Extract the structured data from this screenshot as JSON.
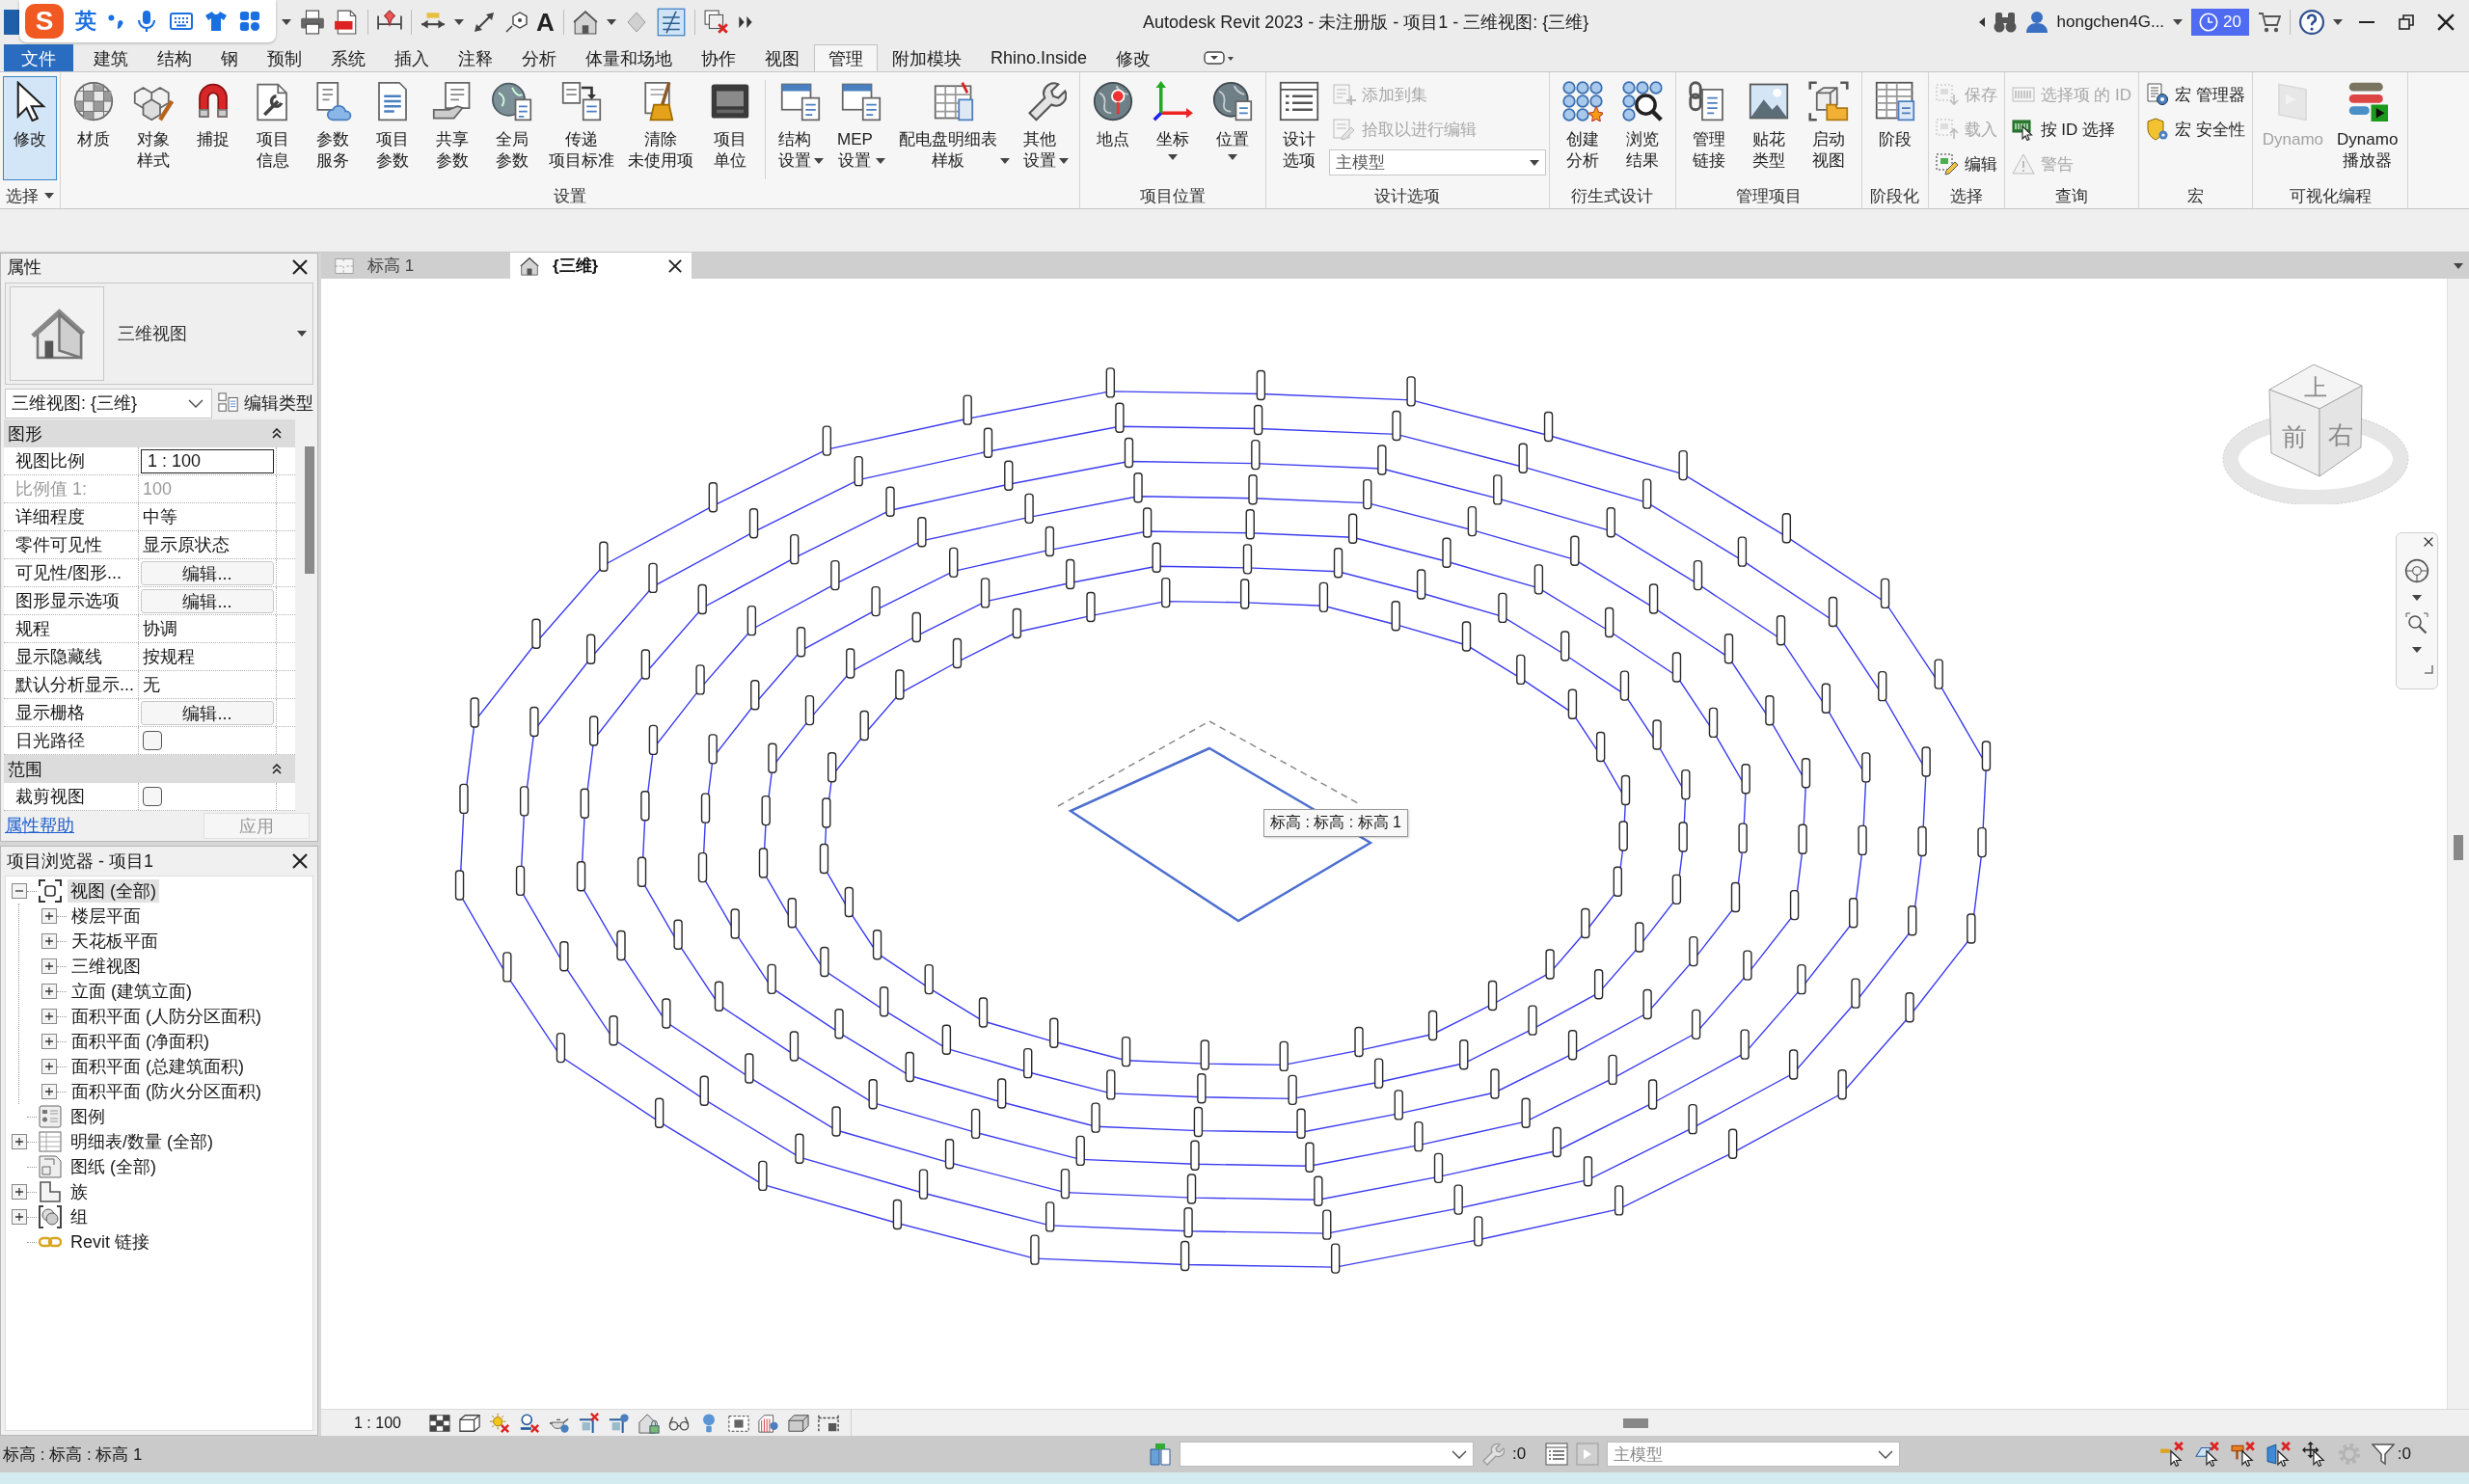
{
  "title_bar": {
    "logo": "S",
    "ime_mode": "英",
    "text_tool": "A",
    "title": "Autodesk Revit 2023 - 未注册版 - 项目1 - 三维视图: {三维}",
    "user": "hongchen4G...",
    "notifications": "20"
  },
  "ribbon": {
    "tabs": [
      {
        "label": "文件",
        "kind": "file",
        "selected": false
      },
      {
        "label": "建筑",
        "kind": "tab",
        "selected": false
      },
      {
        "label": "结构",
        "kind": "tab",
        "selected": false
      },
      {
        "label": "钢",
        "kind": "tab",
        "selected": false
      },
      {
        "label": "预制",
        "kind": "tab",
        "selected": false
      },
      {
        "label": "系统",
        "kind": "tab",
        "selected": false
      },
      {
        "label": "插入",
        "kind": "tab",
        "selected": false
      },
      {
        "label": "注释",
        "kind": "tab",
        "selected": false
      },
      {
        "label": "分析",
        "kind": "tab",
        "selected": false
      },
      {
        "label": "体量和场地",
        "kind": "tab",
        "selected": false
      },
      {
        "label": "协作",
        "kind": "tab",
        "selected": false
      },
      {
        "label": "视图",
        "kind": "tab",
        "selected": false
      },
      {
        "label": "管理",
        "kind": "tab",
        "selected": true
      },
      {
        "label": "附加模块",
        "kind": "tab",
        "selected": false
      },
      {
        "label": "Rhino.Inside",
        "kind": "tab",
        "selected": false
      },
      {
        "label": "修改",
        "kind": "tab",
        "selected": false
      }
    ],
    "panels": [
      {
        "title": "选择",
        "dropdown": true,
        "items": [
          {
            "kind": "large",
            "label": "修改",
            "dropdown": false,
            "active": true,
            "disabled": false
          }
        ]
      },
      {
        "title": "设置",
        "dropdown": false,
        "items": [
          {
            "kind": "large",
            "label": "材质",
            "dropdown": false,
            "active": false,
            "disabled": false
          },
          {
            "kind": "large",
            "label": "对象样式",
            "dropdown": false,
            "active": false,
            "disabled": false
          },
          {
            "kind": "large",
            "label": "捕捉",
            "dropdown": false,
            "active": false,
            "disabled": false
          },
          {
            "kind": "large",
            "label": "项目信息",
            "dropdown": false,
            "active": false,
            "disabled": false
          },
          {
            "kind": "large",
            "label": "参数服务",
            "dropdown": false,
            "active": false,
            "disabled": false
          },
          {
            "kind": "large",
            "label": "项目参数",
            "dropdown": false,
            "active": false,
            "disabled": false
          },
          {
            "kind": "large",
            "label": "共享参数",
            "dropdown": false,
            "active": false,
            "disabled": false
          },
          {
            "kind": "large",
            "label": "全局参数",
            "dropdown": false,
            "active": false,
            "disabled": false
          },
          {
            "kind": "large",
            "label": "传递项目标准",
            "dropdown": false,
            "active": false,
            "disabled": false
          },
          {
            "kind": "large",
            "label": "清除未使用项",
            "dropdown": false,
            "active": false,
            "disabled": false
          },
          {
            "kind": "large",
            "label": "项目单位",
            "dropdown": false,
            "active": false,
            "disabled": false
          },
          {
            "kind": "separator"
          },
          {
            "kind": "large",
            "label": "结构设置",
            "dropdown": true,
            "active": false,
            "disabled": false
          },
          {
            "kind": "large",
            "label": "MEP 设置",
            "dropdown": true,
            "active": false,
            "disabled": false
          },
          {
            "kind": "large",
            "label": "配电盘明细表样板",
            "dropdown": true,
            "active": false,
            "disabled": false
          },
          {
            "kind": "large",
            "label": "其他设置",
            "dropdown": true,
            "active": false,
            "disabled": false
          }
        ]
      },
      {
        "title": "项目位置",
        "dropdown": false,
        "items": [
          {
            "kind": "large",
            "label": "地点",
            "dropdown": false,
            "active": false,
            "disabled": false
          },
          {
            "kind": "large",
            "label": "坐标",
            "dropdown": true,
            "active": false,
            "disabled": false
          },
          {
            "kind": "large",
            "label": "位置",
            "dropdown": true,
            "active": false,
            "disabled": false
          }
        ]
      },
      {
        "title": "设计选项",
        "dropdown": false,
        "items": [
          {
            "kind": "large",
            "label": "设计选项",
            "dropdown": false,
            "active": false,
            "disabled": false
          },
          {
            "kind": "stack",
            "items": [
              {
                "kind": "small",
                "label": "添加到集",
                "disabled": true
              },
              {
                "kind": "small",
                "label": "拾取以进行编辑",
                "disabled": true
              },
              {
                "kind": "combo",
                "value": "主模型"
              }
            ]
          }
        ]
      },
      {
        "title": "衍生式设计",
        "dropdown": false,
        "items": [
          {
            "kind": "large",
            "label": "创建分析",
            "dropdown": false,
            "active": false,
            "disabled": false
          },
          {
            "kind": "large",
            "label": "浏览结果",
            "dropdown": false,
            "active": false,
            "disabled": false
          }
        ]
      },
      {
        "title": "管理项目",
        "dropdown": false,
        "items": [
          {
            "kind": "large",
            "label": "管理链接",
            "dropdown": false,
            "active": false,
            "disabled": false
          },
          {
            "kind": "large",
            "label": "贴花类型",
            "dropdown": false,
            "active": false,
            "disabled": false
          },
          {
            "kind": "large",
            "label": "启动视图",
            "dropdown": false,
            "active": false,
            "disabled": false
          }
        ]
      },
      {
        "title": "阶段化",
        "dropdown": false,
        "items": [
          {
            "kind": "large",
            "label": "阶段",
            "dropdown": false,
            "active": false,
            "disabled": false
          }
        ]
      },
      {
        "title": "选择",
        "dropdown": false,
        "items": [
          {
            "kind": "stack",
            "items": [
              {
                "kind": "small",
                "label": "保存",
                "disabled": true
              },
              {
                "kind": "small",
                "label": "载入",
                "disabled": true
              },
              {
                "kind": "small",
                "label": "编辑",
                "disabled": false
              }
            ]
          }
        ]
      },
      {
        "title": "查询",
        "dropdown": false,
        "items": [
          {
            "kind": "stack",
            "items": [
              {
                "kind": "small",
                "label": "选择项 的 ID",
                "disabled": true
              },
              {
                "kind": "small",
                "label": "按 ID 选择",
                "disabled": false
              },
              {
                "kind": "small",
                "label": "警告",
                "disabled": true
              }
            ]
          }
        ]
      },
      {
        "title": "宏",
        "dropdown": false,
        "items": [
          {
            "kind": "stack",
            "items": [
              {
                "kind": "small",
                "label": "宏 管理器",
                "disabled": false
              },
              {
                "kind": "small",
                "label": "宏 安全性",
                "disabled": false
              }
            ]
          }
        ]
      },
      {
        "title": "可视化编程",
        "dropdown": false,
        "items": [
          {
            "kind": "large",
            "label": "Dynamo",
            "dropdown": false,
            "active": false,
            "disabled": true
          },
          {
            "kind": "large",
            "label": "Dynamo 播放器",
            "dropdown": false,
            "active": false,
            "disabled": false
          }
        ]
      }
    ]
  },
  "properties": {
    "title": "属性",
    "type_name": "三维视图",
    "instance": "三维视图: {三维}",
    "edit_type": "编辑类型",
    "groups": [
      {
        "title": "图形",
        "expanded": true,
        "rows": [
          {
            "label": "视图比例",
            "kind": "input",
            "value": "1 : 100",
            "disabled": false
          },
          {
            "label": "比例值 1:",
            "kind": "text",
            "value": "100",
            "disabled": true
          },
          {
            "label": "详细程度",
            "kind": "text",
            "value": "中等",
            "disabled": false
          },
          {
            "label": "零件可见性",
            "kind": "text",
            "value": "显示原状态",
            "disabled": false
          },
          {
            "label": "可见性/图形...",
            "kind": "button",
            "value": "编辑...",
            "disabled": false
          },
          {
            "label": "图形显示选项",
            "kind": "button",
            "value": "编辑...",
            "disabled": false
          },
          {
            "label": "规程",
            "kind": "text",
            "value": "协调",
            "disabled": false
          },
          {
            "label": "显示隐藏线",
            "kind": "text",
            "value": "按规程",
            "disabled": false
          },
          {
            "label": "默认分析显示...",
            "kind": "text",
            "value": "无",
            "disabled": false
          },
          {
            "label": "显示栅格",
            "kind": "button",
            "value": "编辑...",
            "disabled": false
          },
          {
            "label": "日光路径",
            "kind": "checkbox",
            "checked": false,
            "disabled": false
          }
        ]
      },
      {
        "title": "范围",
        "expanded": true,
        "rows": [
          {
            "label": "裁剪视图",
            "kind": "checkbox",
            "checked": false,
            "disabled": false
          }
        ]
      }
    ],
    "help": "属性帮助",
    "apply": {
      "label": "应用",
      "disabled": true
    }
  },
  "browser": {
    "title": "项目浏览器 - 项目1",
    "tree": [
      {
        "label": "视图 (全部)",
        "kind": "views",
        "expanded": true,
        "selected": true,
        "children": [
          {
            "label": "楼层平面",
            "expanded": false,
            "selected": false
          },
          {
            "label": "天花板平面",
            "expanded": false,
            "selected": false
          },
          {
            "label": "三维视图",
            "expanded": false,
            "selected": false
          },
          {
            "label": "立面 (建筑立面)",
            "expanded": false,
            "selected": false
          },
          {
            "label": "面积平面 (人防分区面积)",
            "expanded": false,
            "selected": false
          },
          {
            "label": "面积平面 (净面积)",
            "expanded": false,
            "selected": false
          },
          {
            "label": "面积平面 (总建筑面积)",
            "expanded": false,
            "selected": false
          },
          {
            "label": "面积平面 (防火分区面积)",
            "expanded": false,
            "selected": false
          }
        ]
      },
      {
        "label": "图例",
        "kind": "legends",
        "selected": false
      },
      {
        "label": "明细表/数量 (全部)",
        "kind": "schedules",
        "expanded": false,
        "selected": false
      },
      {
        "label": "图纸 (全部)",
        "kind": "sheets",
        "selected": false
      },
      {
        "label": "族",
        "kind": "families",
        "expanded": false,
        "selected": false
      },
      {
        "label": "组",
        "kind": "groups",
        "expanded": false,
        "selected": false
      },
      {
        "label": "Revit 链接",
        "kind": "links",
        "selected": false
      }
    ]
  },
  "view": {
    "tabs": [
      {
        "label": "标高 1",
        "kind": "plan",
        "selected": false
      },
      {
        "label": "{三维}",
        "kind": "model",
        "selected": true
      }
    ],
    "level_tag": "标高 : 标高 : 标高 1",
    "view_cube": {
      "top": "上",
      "front": "前",
      "right": "右"
    },
    "scale": "1 : 100"
  },
  "status_bar": {
    "message": "标高 : 标高 : 标高 1",
    "editable_count": ":0",
    "design_option": "主模型",
    "filter_count": ":0"
  }
}
